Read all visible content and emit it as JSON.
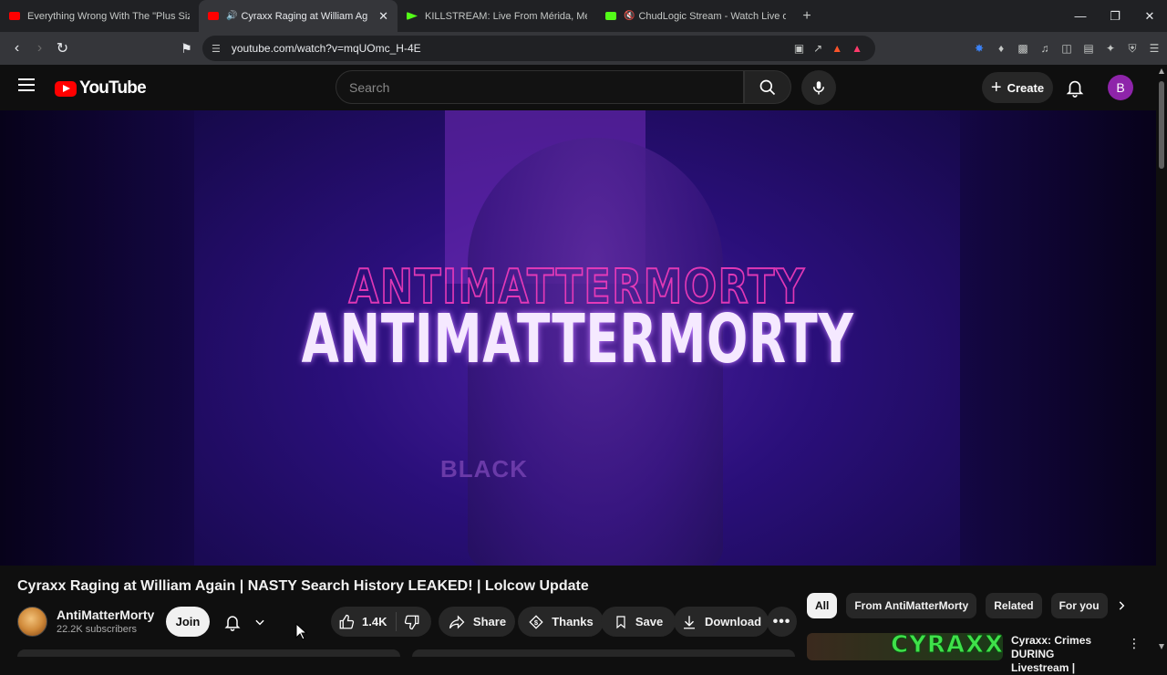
{
  "browser": {
    "tabs": [
      {
        "title": "Everything Wrong With The \"Plus Siz",
        "favicon_color": "#ff0000",
        "active": false
      },
      {
        "title": "Cyraxx Raging at William Ag",
        "favicon_color": "#ff0000",
        "active": true
      },
      {
        "title": "KILLSTREAM: Live From Mérida, Mex",
        "favicon_color": "#53fc18",
        "active": false
      },
      {
        "title": "ChudLogic Stream - Watch Live o",
        "favicon_color": "#53fc18",
        "active": false
      }
    ],
    "address": "youtube.com/watch?v=mqUOmc_H-4E"
  },
  "header": {
    "logo_text": "YouTube",
    "search_placeholder": "Search",
    "create_label": "Create",
    "avatar_letter": "B"
  },
  "player": {
    "brand_text": "ANTIMATTERMORTY",
    "shirt_text": "BLACK"
  },
  "video": {
    "title": "Cyraxx Raging at William Again | NASTY Search History LEAKED! | Lolcow Update",
    "channel_name": "AntiMatterMorty",
    "subscribers": "22.2K subscribers",
    "join_label": "Join",
    "likes": "1.4K",
    "share_label": "Share",
    "thanks_label": "Thanks",
    "save_label": "Save",
    "download_label": "Download"
  },
  "sidebar": {
    "chips": [
      "All",
      "From AntiMatterMorty",
      "Related",
      "For you"
    ],
    "rec_thumb_text": "CYRAXX",
    "rec_title": "Cyraxx: Crimes DURING Livestream |"
  },
  "colors": {
    "accent_red": "#ff0000",
    "avatar_purple": "#8e24aa",
    "background": "#0f0f0f"
  }
}
